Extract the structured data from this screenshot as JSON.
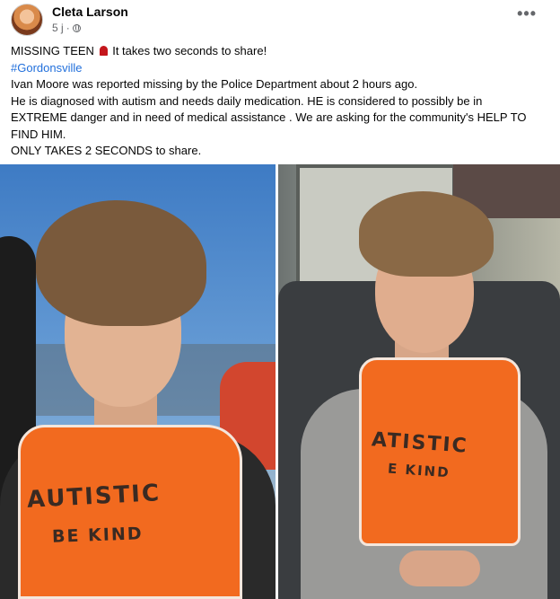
{
  "post": {
    "author": "Cleta Larson",
    "time": "5 j",
    "separator": "·",
    "more_label": "•••",
    "lines": {
      "l1a": "MISSING TEEN",
      "l1b": "It takes two seconds to share!",
      "hashtag": "#Gordonsville",
      "l3": "Ivan Moore was reported missing by the Police Department about 2 hours ago.",
      "l4": "He is diagnosed with autism and needs daily medication. HE is considered to possibly be in",
      "l5": "EXTREME danger and in need of medical assistance . We are asking for the community's HELP TO",
      "l6": "FIND HIM.",
      "l7": "ONLY TAKES 2 SECONDS to share."
    }
  },
  "photos": {
    "left": {
      "vest_line1": "AUTISTIC",
      "vest_line2": "BE KIND"
    },
    "right": {
      "vest_line1": "ATISTIC",
      "vest_line2": "E KIND"
    }
  },
  "colors": {
    "hashtag": "#216fdb",
    "vest": "#f26a1f",
    "meta": "#65676b"
  }
}
